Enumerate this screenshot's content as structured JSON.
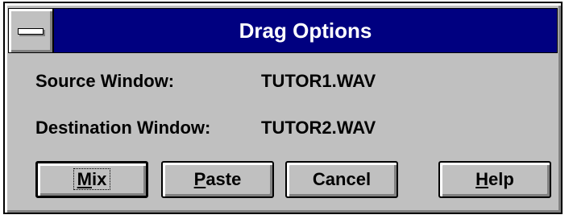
{
  "dialog": {
    "title": "Drag Options",
    "source_label": "Source Window:",
    "source_value": "TUTOR1.WAV",
    "destination_label": "Destination Window:",
    "destination_value": "TUTOR2.WAV"
  },
  "buttons": {
    "mix": {
      "mnemonic": "M",
      "rest": "ix"
    },
    "paste": {
      "mnemonic": "P",
      "rest": "aste"
    },
    "cancel": {
      "label": "Cancel"
    },
    "help": {
      "mnemonic": "H",
      "rest": "elp"
    }
  },
  "icons": {
    "system_menu": "system-menu-icon"
  },
  "colors": {
    "titlebar": "#000080",
    "face": "#c0c0c0",
    "title_text": "#ffffff"
  }
}
